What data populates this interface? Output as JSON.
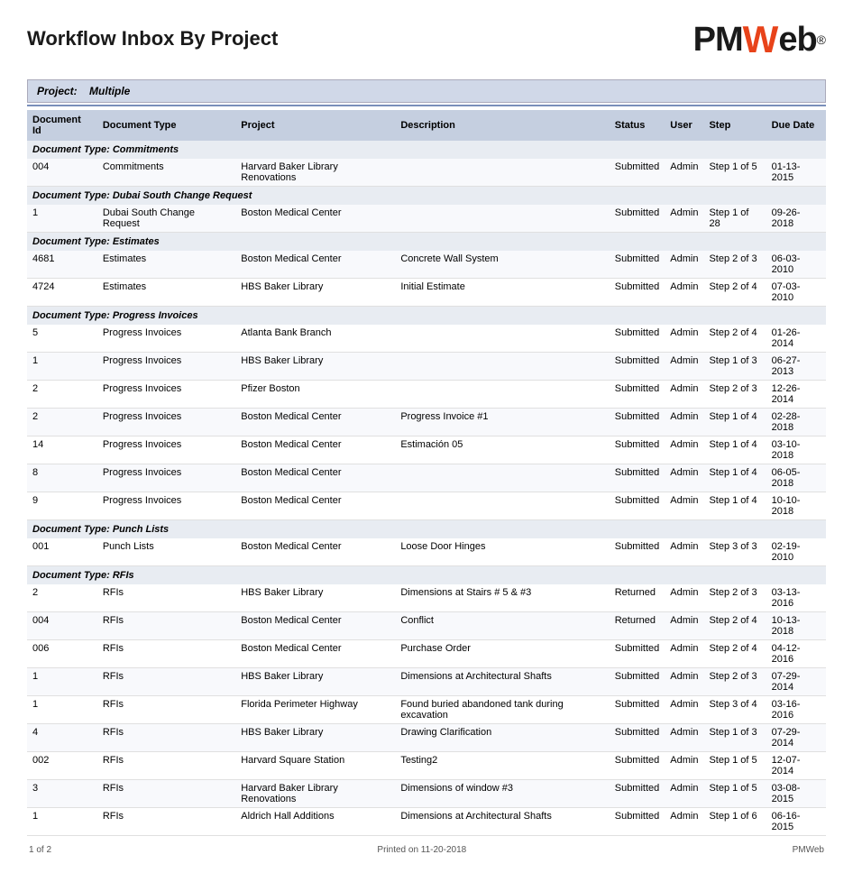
{
  "page": {
    "title": "Workflow Inbox By Project",
    "logo": {
      "prefix": "PM",
      "slash": "W",
      "suffix": "eb",
      "registered": "®"
    },
    "project_label": "Project:",
    "project_value": "Multiple"
  },
  "table": {
    "columns": [
      "Document Id",
      "Document Type",
      "Project",
      "Description",
      "Status",
      "User",
      "Step",
      "Due Date"
    ],
    "sections": [
      {
        "section_title": "Document Type: Commitments",
        "rows": [
          {
            "id": "004",
            "type": "Commitments",
            "project": "Harvard Baker Library Renovations",
            "description": "",
            "status": "Submitted",
            "user": "Admin",
            "step": "Step 1 of 5",
            "due_date": "01-13-2015"
          }
        ]
      },
      {
        "section_title": "Document Type: Dubai South Change Request",
        "rows": [
          {
            "id": "1",
            "type": "Dubai South Change Request",
            "project": "Boston Medical Center",
            "description": "",
            "status": "Submitted",
            "user": "Admin",
            "step": "Step 1 of 28",
            "due_date": "09-26-2018"
          }
        ]
      },
      {
        "section_title": "Document Type: Estimates",
        "rows": [
          {
            "id": "4681",
            "type": "Estimates",
            "project": "Boston Medical Center",
            "description": "Concrete Wall System",
            "status": "Submitted",
            "user": "Admin",
            "step": "Step 2 of 3",
            "due_date": "06-03-2010"
          },
          {
            "id": "4724",
            "type": "Estimates",
            "project": "HBS Baker Library",
            "description": "Initial Estimate",
            "status": "Submitted",
            "user": "Admin",
            "step": "Step 2 of 4",
            "due_date": "07-03-2010"
          }
        ]
      },
      {
        "section_title": "Document Type: Progress Invoices",
        "rows": [
          {
            "id": "5",
            "type": "Progress Invoices",
            "project": "Atlanta Bank Branch",
            "description": "",
            "status": "Submitted",
            "user": "Admin",
            "step": "Step 2 of 4",
            "due_date": "01-26-2014"
          },
          {
            "id": "1",
            "type": "Progress Invoices",
            "project": "HBS Baker Library",
            "description": "",
            "status": "Submitted",
            "user": "Admin",
            "step": "Step 1 of 3",
            "due_date": "06-27-2013"
          },
          {
            "id": "2",
            "type": "Progress Invoices",
            "project": "Pfizer Boston",
            "description": "",
            "status": "Submitted",
            "user": "Admin",
            "step": "Step 2 of 3",
            "due_date": "12-26-2014"
          },
          {
            "id": "2",
            "type": "Progress Invoices",
            "project": "Boston Medical Center",
            "description": "Progress Invoice #1",
            "status": "Submitted",
            "user": "Admin",
            "step": "Step 1 of 4",
            "due_date": "02-28-2018"
          },
          {
            "id": "14",
            "type": "Progress Invoices",
            "project": "Boston Medical Center",
            "description": "Estimación 05",
            "status": "Submitted",
            "user": "Admin",
            "step": "Step 1 of 4",
            "due_date": "03-10-2018"
          },
          {
            "id": "8",
            "type": "Progress Invoices",
            "project": "Boston Medical Center",
            "description": "",
            "status": "Submitted",
            "user": "Admin",
            "step": "Step 1 of 4",
            "due_date": "06-05-2018"
          },
          {
            "id": "9",
            "type": "Progress Invoices",
            "project": "Boston Medical Center",
            "description": "",
            "status": "Submitted",
            "user": "Admin",
            "step": "Step 1 of 4",
            "due_date": "10-10-2018"
          }
        ]
      },
      {
        "section_title": "Document Type: Punch Lists",
        "rows": [
          {
            "id": "001",
            "type": "Punch Lists",
            "project": "Boston Medical Center",
            "description": "Loose Door Hinges",
            "status": "Submitted",
            "user": "Admin",
            "step": "Step 3 of 3",
            "due_date": "02-19-2010"
          }
        ]
      },
      {
        "section_title": "Document Type: RFIs",
        "rows": [
          {
            "id": "2",
            "type": "RFIs",
            "project": "HBS Baker Library",
            "description": "Dimensions at Stairs # 5 & #3",
            "status": "Returned",
            "user": "Admin",
            "step": "Step 2 of 3",
            "due_date": "03-13-2016"
          },
          {
            "id": "004",
            "type": "RFIs",
            "project": "Boston Medical Center",
            "description": "Conflict",
            "status": "Returned",
            "user": "Admin",
            "step": "Step 2 of 4",
            "due_date": "10-13-2018"
          },
          {
            "id": "006",
            "type": "RFIs",
            "project": "Boston Medical Center",
            "description": "Purchase Order",
            "status": "Submitted",
            "user": "Admin",
            "step": "Step 2 of 4",
            "due_date": "04-12-2016"
          },
          {
            "id": "1",
            "type": "RFIs",
            "project": "HBS Baker Library",
            "description": "Dimensions at Architectural Shafts",
            "status": "Submitted",
            "user": "Admin",
            "step": "Step 2 of 3",
            "due_date": "07-29-2014"
          },
          {
            "id": "1",
            "type": "RFIs",
            "project": "Florida Perimeter Highway",
            "description": "Found buried abandoned tank during excavation",
            "status": "Submitted",
            "user": "Admin",
            "step": "Step 3 of 4",
            "due_date": "03-16-2016"
          },
          {
            "id": "4",
            "type": "RFIs",
            "project": "HBS Baker Library",
            "description": "Drawing Clarification",
            "status": "Submitted",
            "user": "Admin",
            "step": "Step 1 of 3",
            "due_date": "07-29-2014"
          },
          {
            "id": "002",
            "type": "RFIs",
            "project": "Harvard Square Station",
            "description": "Testing2",
            "status": "Submitted",
            "user": "Admin",
            "step": "Step 1 of 5",
            "due_date": "12-07-2014"
          },
          {
            "id": "3",
            "type": "RFIs",
            "project": "Harvard Baker Library Renovations",
            "description": "Dimensions of window #3",
            "status": "Submitted",
            "user": "Admin",
            "step": "Step 1 of 5",
            "due_date": "03-08-2015"
          },
          {
            "id": "1",
            "type": "RFIs",
            "project": "Aldrich Hall Additions",
            "description": "Dimensions at Architectural Shafts",
            "status": "Submitted",
            "user": "Admin",
            "step": "Step 1 of 6",
            "due_date": "06-16-2015"
          }
        ]
      }
    ]
  },
  "footer": {
    "page_info": "1 of 2",
    "print_date": "Printed on 11-20-2018",
    "brand": "PMWeb"
  }
}
